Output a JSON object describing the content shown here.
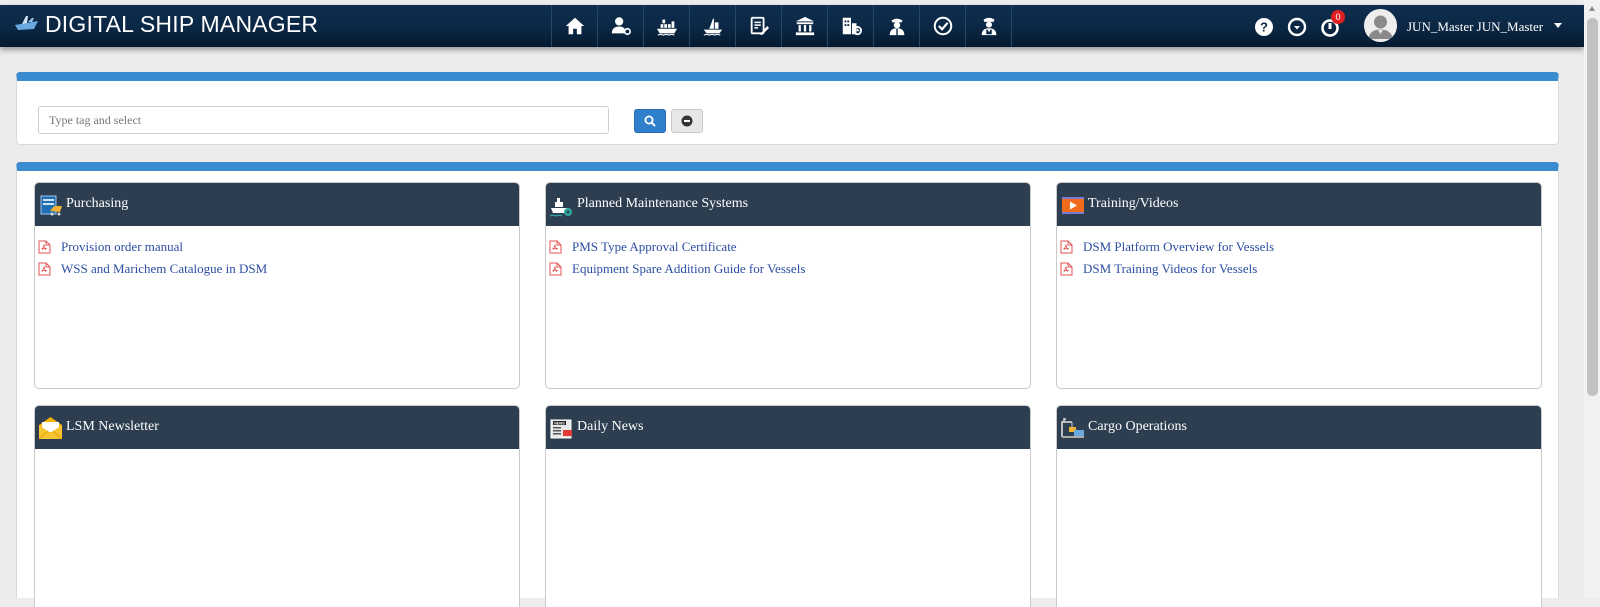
{
  "app": {
    "title": "DIGITAL SHIP MANAGER"
  },
  "nav_icons": [
    "home-icon",
    "user-settings-icon",
    "ship-icon",
    "cargo-ship-icon",
    "document-edit-icon",
    "bank-icon",
    "building-chart-icon",
    "crew-icon",
    "checklist-badge-icon",
    "captain-icon"
  ],
  "header": {
    "help_icon": "question-icon",
    "download_icon": "download-icon",
    "notifications": {
      "icon": "bell-icon",
      "count": "0"
    },
    "user_name": "JUN_Master JUN_Master"
  },
  "search": {
    "placeholder": "Type tag and select",
    "value": ""
  },
  "cards": [
    {
      "title": "Purchasing",
      "icon": "purchasing-icon",
      "links": [
        "Provision order manual",
        "WSS and Marichem Catalogue in DSM"
      ]
    },
    {
      "title": "Planned Maintenance Systems",
      "icon": "maintenance-icon",
      "links": [
        "PMS Type Approval Certificate",
        "Equipment Spare Addition Guide for Vessels"
      ]
    },
    {
      "title": "Training/Videos",
      "icon": "video-icon",
      "links": [
        "DSM Platform Overview for Vessels",
        "DSM Training Videos for Vessels"
      ]
    },
    {
      "title": "LSM Newsletter",
      "icon": "newsletter-icon",
      "links": []
    },
    {
      "title": "Daily News",
      "icon": "news-icon",
      "links": []
    },
    {
      "title": "Cargo Operations",
      "icon": "cargo-icon",
      "links": []
    }
  ],
  "colors": {
    "topbar": "#0b2744",
    "accent": "#3a8bd0",
    "card_header": "#2c3e50",
    "link": "#2b4ea2",
    "pdf": "#e05050"
  }
}
